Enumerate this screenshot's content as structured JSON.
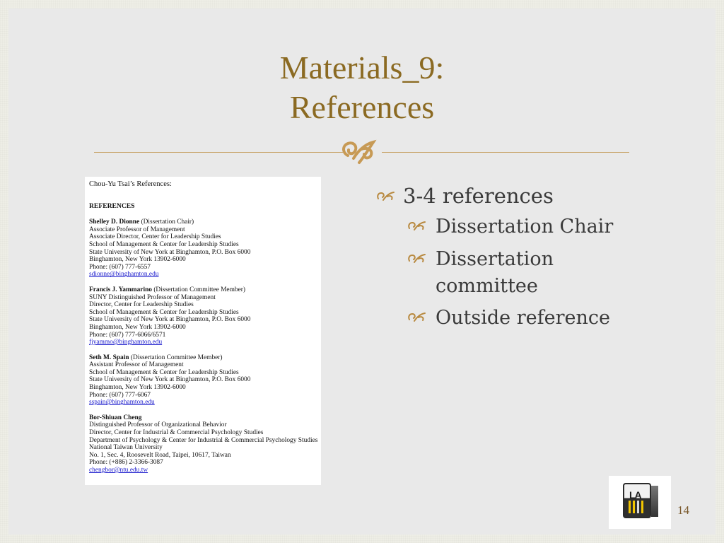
{
  "slide": {
    "title_lines": [
      "Materials_9:",
      "References"
    ],
    "page_number": "14"
  },
  "document": {
    "heading": "Chou-Yu Tsai’s References:",
    "references_title": "REFERENCES",
    "people": [
      {
        "name": "Shelley D. Dionne",
        "role_note": "(Dissertation Chair)",
        "lines": [
          "Associate Professor of Management",
          "Associate Director, Center for Leadership Studies",
          "School of Management & Center for Leadership Studies",
          "State University of New York at Binghamton, P.O. Box 6000",
          "Binghamton, New York 13902-6000",
          "Phone: (607) 777-6557"
        ],
        "email": "sdionne@binghamton.edu"
      },
      {
        "name": "Francis J. Yammarino",
        "role_note": "(Dissertation Committee Member)",
        "lines": [
          "SUNY Distinguished Professor of Management",
          "Director, Center for Leadership Studies",
          "School of Management & Center for Leadership Studies",
          "State University of New York at Binghamton, P.O. Box 6000",
          "Binghamton, New York 13902-6000",
          "Phone: (607) 777-6066/6571"
        ],
        "email": "fjyammo@binghamton.edu"
      },
      {
        "name": "Seth M. Spain",
        "role_note": "(Dissertation Committee Member)",
        "lines": [
          "Assistant Professor of Management",
          "School of Management & Center for Leadership Studies",
          "State University of New York at Binghamton, P.O. Box 6000",
          "Binghamton, New York 13902-6000",
          "Phone: (607) 777-6067"
        ],
        "email": "sspain@binghamton.edu"
      },
      {
        "name": "Bor-Shiuan Cheng",
        "role_note": "",
        "lines": [
          "Distinguished Professor of Organizational Behavior",
          "Director, Center for Industrial & Commercial Psychology Studies",
          "Department of Psychology & Center for Industrial & Commercial Psychology Studies",
          "National Taiwan University",
          "No. 1, Sec. 4, Roosevelt Road, Taipei, 10617, Taiwan",
          "Phone: (+886) 2-3366-3087"
        ],
        "email": "chengbor@ntu.edu.tw"
      }
    ]
  },
  "bullets": {
    "main": "3-4 references",
    "sub": [
      "Dissertation Chair",
      "Dissertation committee",
      "Outside reference"
    ]
  },
  "logo": {
    "text": "LA"
  },
  "colors": {
    "title": "#8b6a22",
    "accent": "#c79a55",
    "body_text": "#3a3a3a"
  },
  "icons": {
    "divider": "fleuron-icon",
    "bullet": "curl-bullet-icon"
  }
}
